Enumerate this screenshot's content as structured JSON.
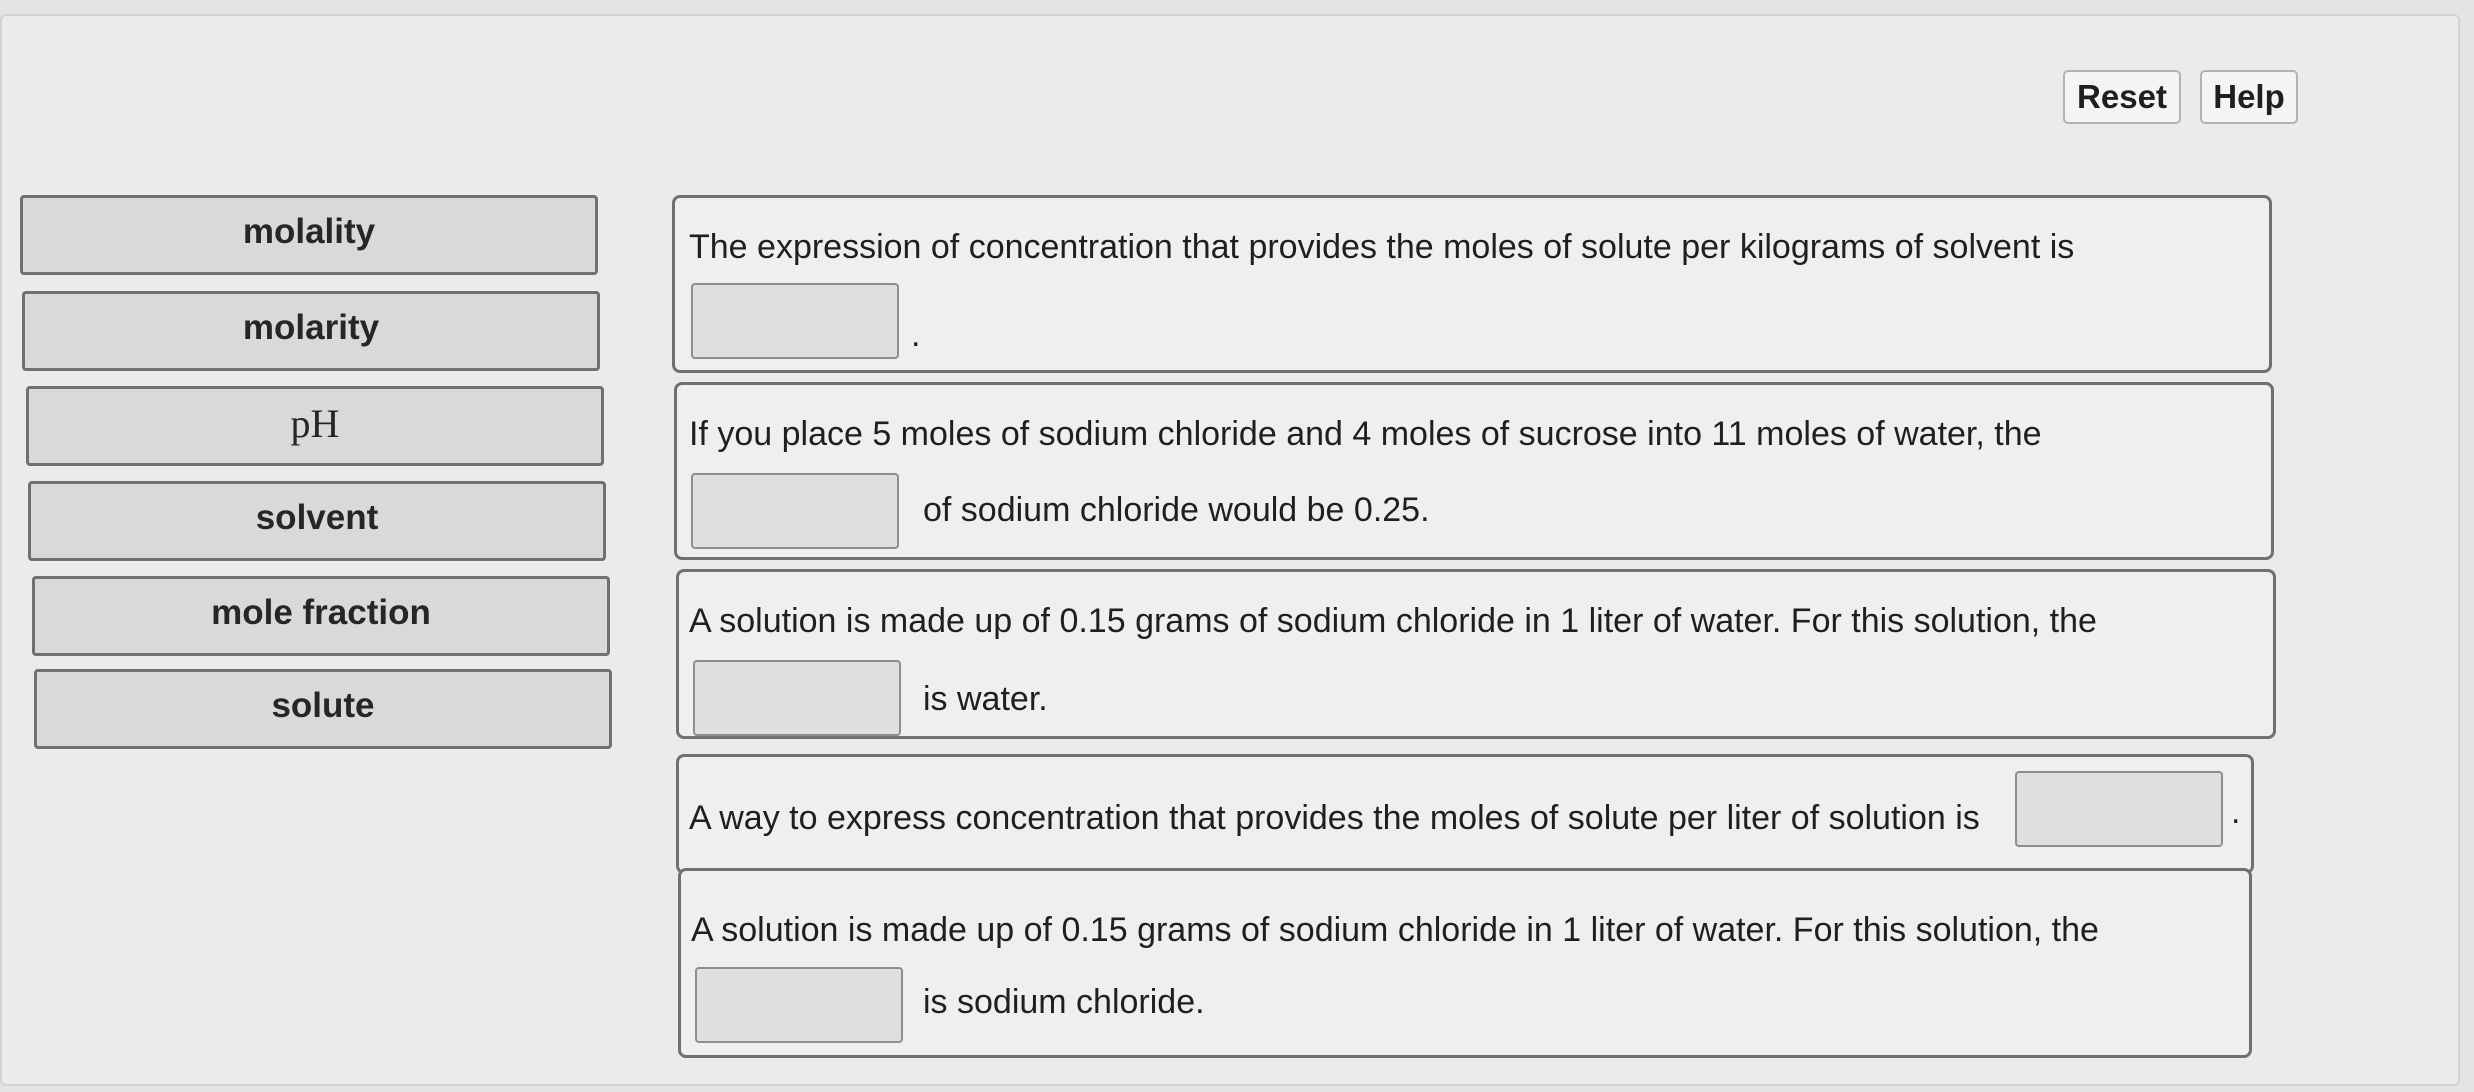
{
  "toolbar": {
    "reset_label": "Reset",
    "help_label": "Help"
  },
  "terms": [
    {
      "label": "molality"
    },
    {
      "label": "molarity"
    },
    {
      "label": "pH"
    },
    {
      "label": "solvent"
    },
    {
      "label": "mole fraction"
    },
    {
      "label": "solute"
    }
  ],
  "questions": [
    {
      "text": "The expression of concentration that provides the moles of solute per kilograms of solvent is",
      "after": "."
    },
    {
      "text": "If you place 5 moles of sodium chloride and 4 moles of sucrose into 11 moles of water, the",
      "after": "of sodium chloride would be 0.25."
    },
    {
      "text": "A solution is made up of 0.15 grams of sodium chloride in 1 liter of water. For this solution, the",
      "after": "is water."
    },
    {
      "text": "A way to express concentration that provides the moles of solute per liter of solution is",
      "after": "."
    },
    {
      "text": "A solution is made up of 0.15 grams of sodium chloride in 1 liter of water. For this solution, the",
      "after": "is sodium chloride."
    }
  ]
}
